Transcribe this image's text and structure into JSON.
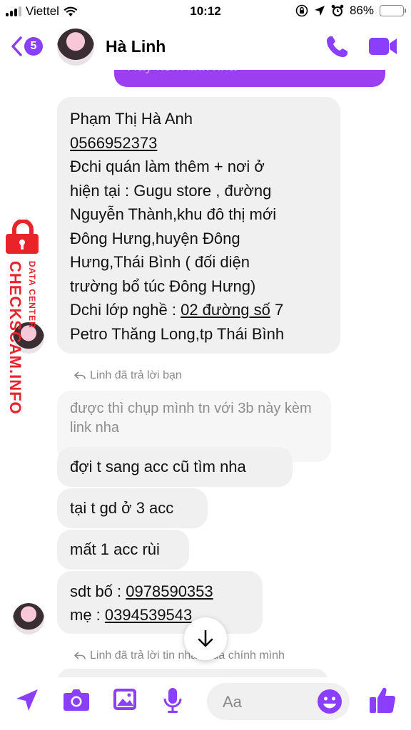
{
  "status_bar": {
    "carrier": "Viettel",
    "time": "10:12",
    "battery_percent": "86%",
    "battery_level": 0.86
  },
  "header": {
    "back_badge": "5",
    "contact_name": "Hà Linh"
  },
  "top_partial_message": "Hay kèm link nha",
  "messages": {
    "info_lines": [
      "Phạm Thị Hà Anh",
      "0566952373",
      "Đchi quán làm thêm + nơi ở",
      "hiện tại : Gugu store , đường",
      "Nguyễn Thành,khu đô thị mới",
      "Đông Hưng,huyện Đông",
      "Hưng,Thái Bình ( đối diện",
      "trường bổ túc Đông Hưng)",
      "Dchi lớp nghề : ",
      "02 đường số",
      " 7",
      "Petro Thăng Long,tp Thái Bình"
    ],
    "reply_label_1": "Linh đã trả lời bạn",
    "quoted_text": "được thì chụp mình tn với 3b này kèm link nha",
    "msg_2": "đợi t sang acc cũ tìm nha",
    "msg_3": "tại t gd ở 3 acc",
    "msg_4": "mất 1 acc rùi",
    "msg_5_label_1": "sdt bố : ",
    "msg_5_phone_1": "0978590353",
    "msg_5_label_2": "mẹ : ",
    "msg_5_phone_2": "0394539543",
    "reply_label_2": "Linh đã trả lời tin nhắn của chính mình"
  },
  "watermark": {
    "main": "CHECKSCAM.INFO",
    "sub": "DATA CENTER"
  },
  "composer": {
    "placeholder": "Aa"
  },
  "colors": {
    "accent": "#8a3ffc",
    "outgoing_bubble": "#9b3ff0",
    "incoming_bubble": "#f0f0f0",
    "watermark_red": "#e8232a",
    "battery_yellow": "#f5c400"
  }
}
